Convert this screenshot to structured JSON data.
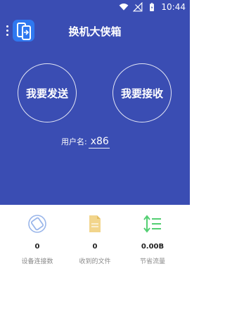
{
  "status_bar": {
    "time": "10:44",
    "icons": [
      "wifi-icon",
      "signal-icon",
      "battery-icon"
    ]
  },
  "app_bar": {
    "title": "换机大侠箱",
    "icon": "app-logo-icon",
    "menu_icon": "more-vert-icon"
  },
  "actions": {
    "send_label": "我要发送",
    "receive_label": "我要接收"
  },
  "user": {
    "label": "用户名:",
    "name": "x86"
  },
  "stats": [
    {
      "icon": "device-rotate-icon",
      "value": "0",
      "label": "设备连接数"
    },
    {
      "icon": "file-icon",
      "value": "0",
      "label": "收到的文件"
    },
    {
      "icon": "traffic-sort-icon",
      "value": "0.00B",
      "label": "节省流量"
    }
  ],
  "colors": {
    "primary": "#3a4db3",
    "app_icon": "#2f78f0",
    "device_icon": "#9ab6ea",
    "file_icon": "#f2d58c",
    "traffic_icon": "#53cf72"
  }
}
